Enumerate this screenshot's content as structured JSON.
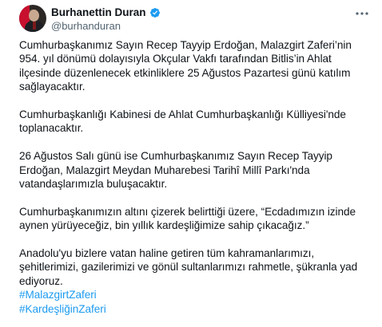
{
  "author": {
    "display_name": "Burhanettin Duran",
    "handle": "@burhanduran",
    "verified_color": "#1d9bf0"
  },
  "icons": {
    "verified": "verified-badge-icon",
    "more": "more-options-icon"
  },
  "tweet": {
    "paragraphs": [
      "Cumhurbaşkanımız Sayın Recep Tayyip Erdoğan, Malazgirt Zaferi’nin\n954. yıl dönümü dolayısıyla Okçular Vakfı tarafından Bitlis’in Ahlat\nilçesinde düzenlenecek etkinliklere 25 Ağustos Pazartesi günü katılım\nsağlayacaktır.",
      "Cumhurbaşkanlığı Kabinesi de Ahlat Cumhurbaşkanlığı Külliyesi'nde\ntoplanacaktır.",
      "26 Ağustos Salı günü ise Cumhurbaşkanımız Sayın Recep Tayyip\nErdoğan, Malazgirt Meydan Muharebesi Tarihî Millî Parkı'nda\nvatandaşlarımızla buluşacaktır.",
      "Cumhurbaşkanımızın altını çizerek belirttiği üzere, “Ecdadımızın izinde\naynen yürüyeceğiz, bin yıllık kardeşliğimize sahip çıkacağız.”",
      "Anadolu'yu bizlere vatan haline getiren tüm kahramanlarımızı,\nşehitlerimizi, gazilerimizi ve gönül sultanlarımızı rahmetle, şükranla yad\nediyoruz."
    ],
    "hashtags": [
      "#MalazgirtZaferi",
      "#KardeşliğinZaferi"
    ],
    "link_color": "#1d9bf0"
  }
}
